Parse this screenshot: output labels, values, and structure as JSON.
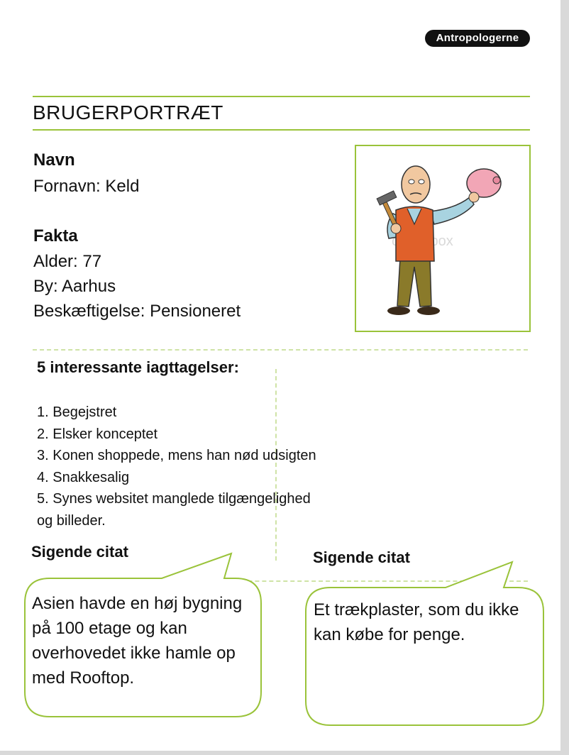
{
  "logo": {
    "text": "Antropologerne"
  },
  "title": "BRUGERPORTRÆT",
  "name_section": {
    "heading": "Navn",
    "first_name": "Fornavn: Keld"
  },
  "facts_section": {
    "heading": "Fakta",
    "age": "Alder: 77",
    "city": "By: Aarhus",
    "occupation": "Beskæftigelse: Pensioneret"
  },
  "photo": {
    "icon": "old-man-with-piggy-bank-illustration",
    "watermark": "colourbox"
  },
  "observations": {
    "heading": "5 interessante iagttagelser:",
    "items": [
      "1.  Begejstret",
      "2.  Elsker konceptet",
      "3.  Konen shoppede, mens han nød udsigten",
      "4. Snakkesalig",
      "5. Synes websitet manglede tilgængelighed",
      "og billeder."
    ]
  },
  "quotes": [
    {
      "heading": "Sigende citat",
      "lines": [
        "Asien havde en høj bygning",
        "på 100 etage og kan",
        "overhovedet ikke hamle op",
        "med  Rooftop."
      ]
    },
    {
      "heading": "Sigende citat",
      "lines": [
        "Et trækplaster, som du ikke",
        "kan købe for penge."
      ]
    }
  ],
  "colors": {
    "accent": "#9ac33a",
    "dashed": "#cfe3a6"
  }
}
